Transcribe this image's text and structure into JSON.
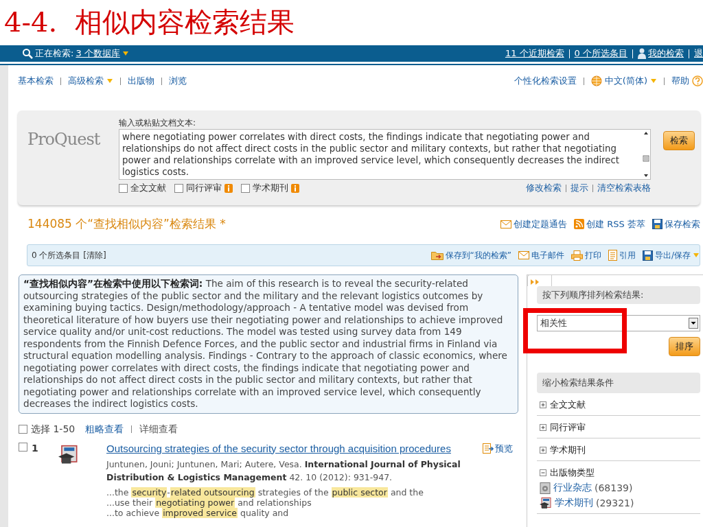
{
  "slide_title": "4-4.  相似内容检索结果",
  "top_bar": {
    "searching_label": "正在检索:",
    "databases_link": "3 个数据库",
    "links": [
      {
        "kind": "link",
        "label": "11 个近期检索"
      },
      {
        "kind": "link",
        "label": "0 个所选条目"
      },
      {
        "kind": "user",
        "label": "我的检索"
      },
      {
        "kind": "link",
        "label": "退"
      }
    ]
  },
  "nav": {
    "left": [
      {
        "label": "基本检索",
        "menu": false
      },
      {
        "label": "高级检索",
        "menu": true
      },
      {
        "label": "出版物",
        "menu": false
      },
      {
        "label": "浏览",
        "menu": false
      }
    ],
    "right": [
      {
        "kind": "link",
        "label": "个性化检索设置"
      },
      {
        "kind": "language",
        "label": "中文(简体)"
      },
      {
        "kind": "help",
        "label": "帮助"
      }
    ]
  },
  "search_panel": {
    "logo": "ProQuest",
    "field_label": "输入或粘贴文档文本:",
    "text": "where negotiating power correlates with direct costs, the findings indicate that negotiating power and relationships do not affect direct costs in the public sector and military contexts, but rather that negotiating power and relationships correlate with an improved service level, which consequently decreases the indirect logistics costs.",
    "filters": [
      {
        "label": "全文文献",
        "checked": false,
        "info": false
      },
      {
        "label": "同行评审",
        "checked": false,
        "info": true
      },
      {
        "label": "学术期刊",
        "checked": false,
        "info": true
      }
    ],
    "button": "检索",
    "links": [
      "修改检索",
      "提示",
      "清空检索表格"
    ]
  },
  "results_header": {
    "title": "144085 个“查找相似内容”检索结果 *",
    "actions": [
      {
        "kind": "mail",
        "label": "创建定题通告"
      },
      {
        "kind": "rss",
        "label": "创建 RSS 荟萃"
      },
      {
        "kind": "save",
        "label": "保存检索"
      }
    ]
  },
  "selection_bar": {
    "count": "0 个所选条目 [清除]",
    "actions": [
      {
        "kind": "folder",
        "label": "保存到“我的检索”"
      },
      {
        "kind": "mail",
        "label": "电子邮件"
      },
      {
        "kind": "print",
        "label": "打印"
      },
      {
        "kind": "cite",
        "label": "引用"
      },
      {
        "kind": "save",
        "label": "导出/保存",
        "menu": true
      }
    ]
  },
  "query_box": {
    "text": "**“查找相似内容”在检索中使用以下检索词:** The aim of this research is to reveal the security-related outsourcing strategies of the public sector and the military and the relevant logistics outcomes by examining buying tactics. Design/methodology/approach - A tentative model was devised from theoretical literature of how buyers use their negotiating power and relationships to achieve improved service quality and/or unit-cost reductions. The model was tested using survey data from 149 respondents from the Finnish Defence Forces, and the public sector and industrial firms in Finland via structural equation modelling analysis. Findings - Contrary to the approach of classic economics, where negotiating power correlates with direct costs, the findings indicate that negotiating power and relationships do not affect direct costs in the public sector and military contexts, but rather that negotiating power and relationships correlate with an improved service level, which consequently decreases the indirect logistics costs."
  },
  "list_controls": {
    "select_all": {
      "label": "选择 1-50",
      "checked": false
    },
    "views": [
      {
        "label": "粗略查看",
        "selected": false
      },
      {
        "label": "详细查看",
        "selected": true
      }
    ]
  },
  "results": [
    {
      "number": "1",
      "checked": false,
      "title": "Outsourcing strategies of the security sector through acquisition procedures",
      "preview": "预览",
      "citation": "Juntunen, Jouni; Juntunen, Mari; Autere, Vesa. **International Journal of Physical Distribution & Logistics Management** 42. 10  (2012): 931-947.",
      "snippets": [
        [
          {
            "text": "...the ",
            "highlight": false
          },
          {
            "text": "security",
            "highlight": true
          },
          {
            "text": "-",
            "highlight": false
          },
          {
            "text": "related outsourcing",
            "highlight": true
          },
          {
            "text": " strategies of the ",
            "highlight": false
          },
          {
            "text": "public sector",
            "highlight": true
          },
          {
            "text": " and the",
            "highlight": false
          }
        ],
        [
          {
            "text": "...use their ",
            "highlight": false
          },
          {
            "text": "negotiating power",
            "highlight": true
          },
          {
            "text": " and relationships",
            "highlight": false
          }
        ],
        [
          {
            "text": "...to achieve ",
            "highlight": false
          },
          {
            "text": "improved service",
            "highlight": true
          },
          {
            "text": " quality and",
            "highlight": false
          }
        ]
      ]
    }
  ],
  "sidebar": {
    "sort_label": "按下列顺序排列检索结果:",
    "sort_value": "相关性",
    "sort_button": "排序",
    "narrow_label": "缩小检索结果条件",
    "facets": [
      {
        "label": "全文文献",
        "expanded": false
      },
      {
        "label": "同行评审",
        "expanded": false
      },
      {
        "label": "学术期刊",
        "expanded": false
      },
      {
        "label": "出版物类型",
        "expanded": true,
        "children": [
          {
            "label": "行业杂志",
            "count": "(68139)"
          },
          {
            "label": "学术期刊",
            "count": "(29321)"
          }
        ]
      }
    ]
  }
}
